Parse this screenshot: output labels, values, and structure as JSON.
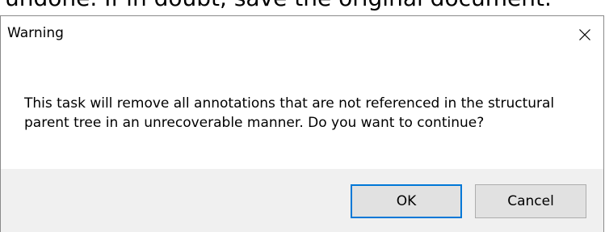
{
  "background": {
    "text": "undone. If in doubt, save the original document."
  },
  "dialog": {
    "title": "Warning",
    "close_icon": "close-icon",
    "message": "This task will remove all annotations that are not referenced in the structural parent tree in an unrecoverable manner. Do you want to continue?",
    "buttons": {
      "ok_label": "OK",
      "cancel_label": "Cancel"
    },
    "colors": {
      "footer_bg": "#f0f0f0",
      "button_bg": "#e1e1e1",
      "focus_border": "#0078d7"
    }
  }
}
